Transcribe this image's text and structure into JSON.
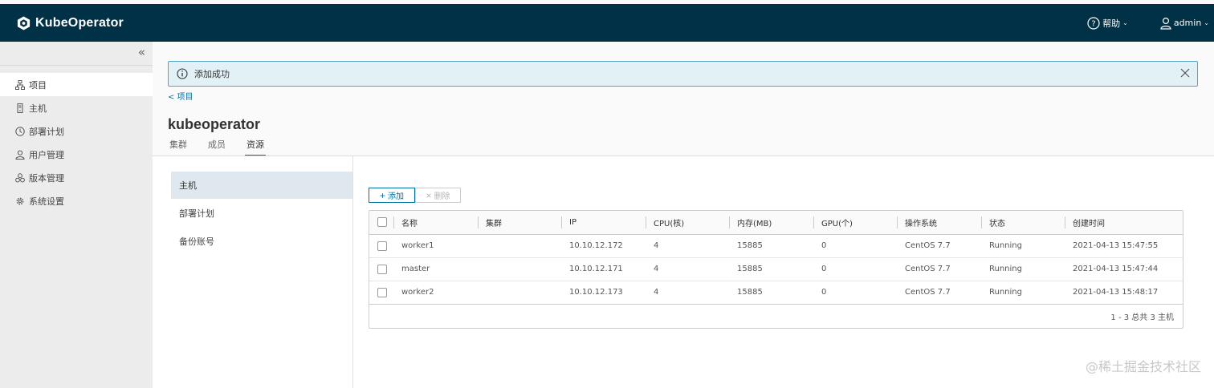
{
  "app": {
    "title": "KubeOperator"
  },
  "header": {
    "help_label": "帮助",
    "user_label": "admin"
  },
  "sidebar": {
    "collapse_glyph": "«",
    "items": [
      {
        "label": "项目",
        "icon": "project-icon",
        "active": true
      },
      {
        "label": "主机",
        "icon": "host-icon"
      },
      {
        "label": "部署计划",
        "icon": "plan-icon"
      },
      {
        "label": "用户管理",
        "icon": "user-icon"
      },
      {
        "label": "版本管理",
        "icon": "version-icon"
      },
      {
        "label": "系统设置",
        "icon": "gear-icon"
      }
    ]
  },
  "alert": {
    "text": "添加成功",
    "icon": "info-icon"
  },
  "breadcrumb": {
    "text": "< 项目"
  },
  "page": {
    "title": "kubeoperator"
  },
  "tabs": [
    {
      "label": "集群"
    },
    {
      "label": "成员"
    },
    {
      "label": "资源",
      "active": true
    }
  ],
  "subnav": [
    {
      "label": "主机",
      "active": true
    },
    {
      "label": "部署计划"
    },
    {
      "label": "备份账号"
    }
  ],
  "toolbar": {
    "add_label": "添加",
    "delete_label": "删除"
  },
  "table": {
    "columns": [
      "名称",
      "集群",
      "IP",
      "CPU(核)",
      "内存(MB)",
      "GPU(个)",
      "操作系统",
      "状态",
      "创建时间"
    ],
    "rows": [
      [
        "worker1",
        "",
        "10.10.12.172",
        "4",
        "15885",
        "0",
        "CentOS 7.7",
        "Running",
        "2021-04-13 15:47:55"
      ],
      [
        "master",
        "",
        "10.10.12.171",
        "4",
        "15885",
        "0",
        "CentOS 7.7",
        "Running",
        "2021-04-13 15:47:44"
      ],
      [
        "worker2",
        "",
        "10.10.12.173",
        "4",
        "15885",
        "0",
        "CentOS 7.7",
        "Running",
        "2021-04-13 15:48:17"
      ]
    ],
    "footer": "1 - 3 总共 3 主机"
  },
  "watermark": "@稀土掘金技术社区",
  "colors": {
    "header_bg": "#003146",
    "accent": "#0072a3",
    "alert_bg": "#e1f1f6"
  }
}
